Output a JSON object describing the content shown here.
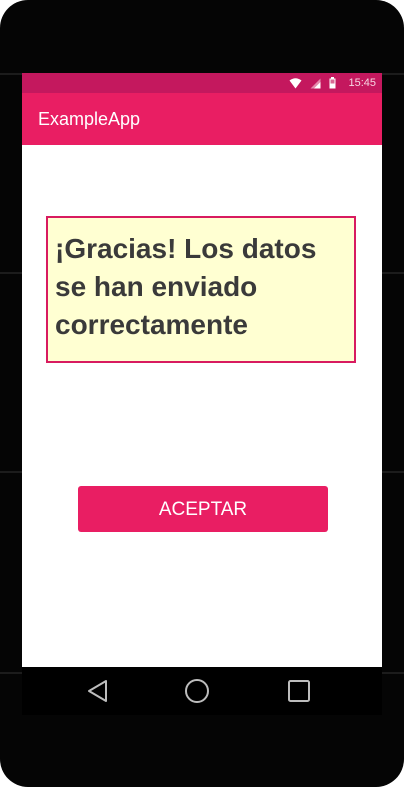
{
  "status_bar": {
    "time": "15:45",
    "icons": [
      "wifi-icon",
      "cell-signal-icon",
      "battery-icon"
    ]
  },
  "app_bar": {
    "title": "ExampleApp"
  },
  "message": {
    "text": "¡Gracias! Los datos se han enviado correctamente"
  },
  "accept_button": {
    "label": "ACEPTAR"
  },
  "nav_bar": {
    "icons": [
      "back-icon",
      "home-icon",
      "recents-icon"
    ]
  },
  "colors": {
    "primary": "#e91e63",
    "primary_dark": "#c4185e",
    "message_background": "#ffffd2",
    "message_border": "#d81b60",
    "message_text": "#3a3a3a"
  }
}
